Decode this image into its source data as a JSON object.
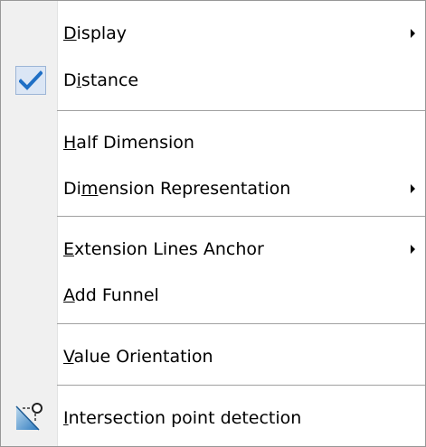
{
  "menu": {
    "items": [
      {
        "prefix": "",
        "mnemonic": "D",
        "suffix": "isplay",
        "submenu": true
      },
      {
        "prefix": "D",
        "mnemonic": "i",
        "suffix": "stance",
        "checked": true
      },
      {
        "prefix": "",
        "mnemonic": "H",
        "suffix": "alf Dimension"
      },
      {
        "prefix": "Di",
        "mnemonic": "m",
        "suffix": "ension Representation",
        "submenu": true
      },
      {
        "prefix": "",
        "mnemonic": "E",
        "suffix": "xtension Lines Anchor",
        "submenu": true
      },
      {
        "prefix": "",
        "mnemonic": "A",
        "suffix": "dd Funnel"
      },
      {
        "prefix": "",
        "mnemonic": "V",
        "suffix": "alue Orientation"
      },
      {
        "prefix": "",
        "mnemonic": "I",
        "suffix": "ntersection point detection",
        "icon": "intersection-point-icon"
      }
    ]
  },
  "icons": {
    "check": "checkmark-icon",
    "submenu": "submenu-arrow-icon"
  },
  "colors": {
    "check": "#1f6fc5",
    "check_bg": "#dbe6f5",
    "gutter": "#f0f0f0",
    "separator": "#a0a0a0"
  }
}
